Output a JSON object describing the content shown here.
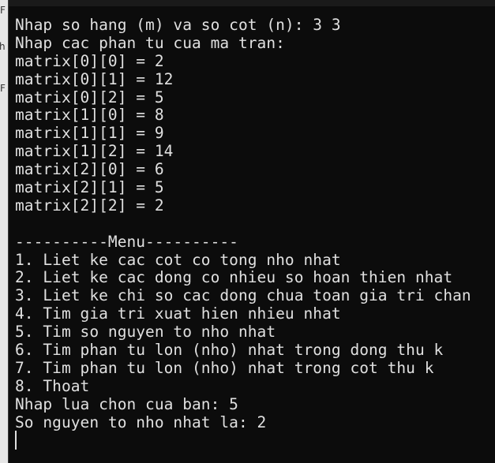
{
  "background_window": {
    "fragments": [
      "F",
      "h",
      "F"
    ]
  },
  "terminal": {
    "lines": [
      "Nhap so hang (m) va so cot (n): 3 3",
      "Nhap cac phan tu cua ma tran:",
      "matrix[0][0] = 2",
      "matrix[0][1] = 12",
      "matrix[0][2] = 5",
      "matrix[1][0] = 8",
      "matrix[1][1] = 9",
      "matrix[1][2] = 14",
      "matrix[2][0] = 6",
      "matrix[2][1] = 5",
      "matrix[2][2] = 2",
      "",
      "----------Menu----------",
      "1. Liet ke cac cot co tong nho nhat",
      "2. Liet ke cac dong co nhieu so hoan thien nhat",
      "3. Liet ke chi so cac dong chua toan gia tri chan",
      "4. Tim gia tri xuat hien nhieu nhat",
      "5. Tim so nguyen to nho nhat",
      "6. Tim phan tu lon (nho) nhat trong dong thu k",
      "7. Tim phan tu lon (nho) nhat trong cot thu k",
      "8. Thoat",
      "Nhap lua chon cua ban: 5",
      "So nguyen to nho nhat la: 2"
    ]
  },
  "colors": {
    "background": "#0c0c0c",
    "text": "#e0e0e0"
  }
}
